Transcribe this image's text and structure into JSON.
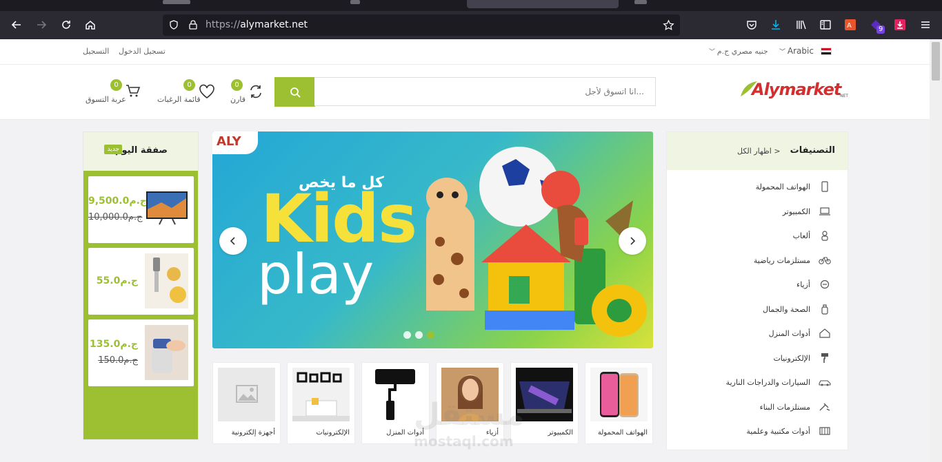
{
  "browser": {
    "url_protocol": "https://",
    "url_host": "alymarket.net",
    "extension_badge": "9"
  },
  "topbar": {
    "language": "Arabic",
    "currency": "جنيه مصري ج.م",
    "login": "تسجيل الدخول",
    "register": "التسجيل"
  },
  "header": {
    "search_placeholder": "انا اتسوق لأجل...",
    "compare_label": "قارن",
    "compare_count": "0",
    "wishlist_label": "قائمة الرغبات",
    "wishlist_count": "0",
    "cart_label": "عربة التسوق",
    "cart_count": "0",
    "logo_text": "Alymarket",
    "logo_suffix": "NET"
  },
  "categories": {
    "title": "التصنيفات",
    "show_all": "اظهار الكل >",
    "items": [
      {
        "label": "الهواتف المحمولة",
        "icon": "phone-icon"
      },
      {
        "label": "الكمبيوتر",
        "icon": "laptop-icon"
      },
      {
        "label": "ألعاب",
        "icon": "toy-icon"
      },
      {
        "label": "مستلزمات رياضية",
        "icon": "bicycle-icon"
      },
      {
        "label": "أزياء",
        "icon": "fashion-icon"
      },
      {
        "label": "الصحة والجمال",
        "icon": "beauty-icon"
      },
      {
        "label": "أدوات المنزل",
        "icon": "home-icon"
      },
      {
        "label": "الإلكترونيات",
        "icon": "paint-roller-icon"
      },
      {
        "label": "السيارات والدراجات النارية",
        "icon": "car-icon"
      },
      {
        "label": "مستلزمات البناء",
        "icon": "construction-icon"
      },
      {
        "label": "أدوات مكتبية وعلمية",
        "icon": "book-icon"
      }
    ]
  },
  "slider": {
    "arabic_text": "كل ما يخص",
    "headline1": "Kids",
    "headline2": "play",
    "brand": "ALY",
    "active_dot": 2
  },
  "deal": {
    "title": "صفقة اليوم",
    "tag": "جديد",
    "items": [
      {
        "price": "9,500.0ج.م",
        "old_price": "10,000.0ج.م",
        "image": "tv"
      },
      {
        "price": "55.0ج.م",
        "old_price": "",
        "image": "blender"
      },
      {
        "price": "135.0ج.م",
        "old_price": "150.0ج.م",
        "image": "chopper"
      }
    ]
  },
  "tiles": [
    {
      "label": "الهواتف المحمولة",
      "image": "phones"
    },
    {
      "label": "الكمبيوتر",
      "image": "laptop"
    },
    {
      "label": "أزياء",
      "image": "woman"
    },
    {
      "label": "أدوات المنزل",
      "image": "roller"
    },
    {
      "label": "الإلكترونيات",
      "image": "room"
    },
    {
      "label": "أجهزة إلكترونية",
      "image": "placeholder"
    }
  ],
  "watermark": {
    "text1": "مستقل",
    "text2": "mostaql.com"
  }
}
